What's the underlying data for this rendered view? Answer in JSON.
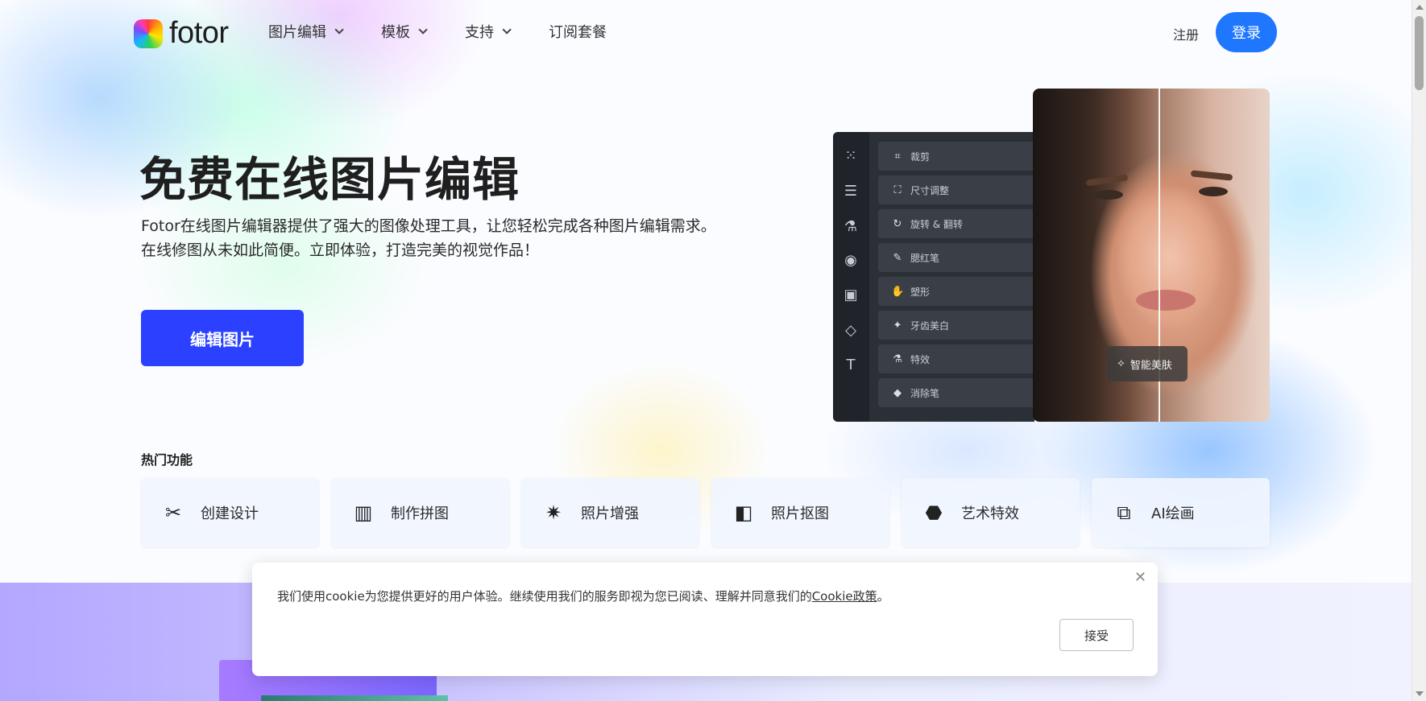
{
  "header": {
    "logo_text": "fotor",
    "nav": [
      {
        "label": "图片编辑",
        "has_dropdown": true
      },
      {
        "label": "模板",
        "has_dropdown": true
      },
      {
        "label": "支持",
        "has_dropdown": true
      },
      {
        "label": "订阅套餐",
        "has_dropdown": false
      }
    ],
    "signup_label": "注册",
    "login_label": "登录"
  },
  "hero": {
    "title": "免费在线图片编辑",
    "desc_line1": "Fotor在线图片编辑器提供了强大的图像处理工具，让您轻松完成各种图片编辑需求。",
    "desc_line2": "在线修图从未如此简便。立即体验，打造完美的视觉作品！",
    "cta_label": "编辑图片"
  },
  "editor_preview": {
    "rail_icons": [
      "grid-icon",
      "sliders-icon",
      "flask-icon",
      "eye-icon",
      "frame-icon",
      "shapes-icon",
      "text-icon"
    ],
    "tools": [
      {
        "icon": "crop-icon",
        "label": "裁剪"
      },
      {
        "icon": "resize-icon",
        "label": "尺寸调整"
      },
      {
        "icon": "rotate-icon",
        "label": "旋转 & 翻转"
      },
      {
        "icon": "blush-brush-icon",
        "label": "腮红笔"
      },
      {
        "icon": "reshape-icon",
        "label": "塑形"
      },
      {
        "icon": "tooth-icon",
        "label": "牙齿美白"
      },
      {
        "icon": "effect-icon",
        "label": "特效"
      },
      {
        "icon": "eraser-icon",
        "label": "消除笔"
      }
    ],
    "badge_label": "智能美肤"
  },
  "hot_features": {
    "title": "热门功能",
    "items": [
      {
        "icon": "design-tools-icon",
        "label": "创建设计"
      },
      {
        "icon": "collage-icon",
        "label": "制作拼图"
      },
      {
        "icon": "sparkle-enhance-icon",
        "label": "照片增强"
      },
      {
        "icon": "cutout-icon",
        "label": "照片抠图"
      },
      {
        "icon": "art-effect-icon",
        "label": "艺术特效"
      },
      {
        "icon": "ai-paint-icon",
        "label": "AI绘画"
      }
    ]
  },
  "cookie_banner": {
    "text": "我们使用cookie为您提供更好的用户体验。继续使用我们的服务即视为您已阅读、理解并同意我们的",
    "link_label": "Cookie政策",
    "suffix": "。",
    "accept_label": "接受"
  },
  "colors": {
    "primary_blue": "#1f77ff",
    "cta_blue": "#2b41ff"
  }
}
